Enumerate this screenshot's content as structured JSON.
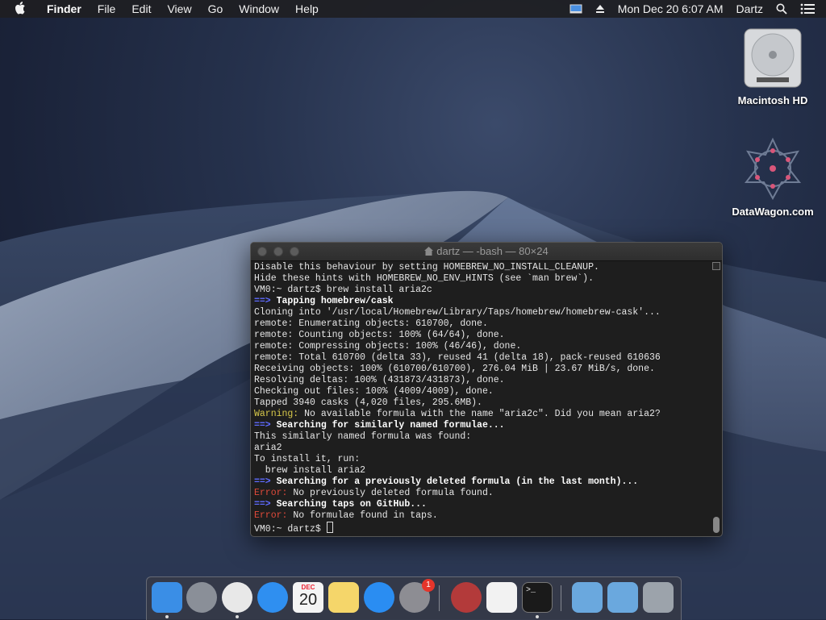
{
  "menubar": {
    "items": [
      "Finder",
      "File",
      "Edit",
      "View",
      "Go",
      "Window",
      "Help"
    ],
    "datetime": "Mon Dec 20  6:07 AM",
    "user": "Dartz"
  },
  "desktop_icons": [
    {
      "label": "Macintosh HD"
    },
    {
      "label": "DataWagon.com"
    }
  ],
  "terminal": {
    "title": "dartz — -bash — 80×24",
    "lines": [
      {
        "parts": [
          {
            "t": "Disable this behaviour by setting HOMEBREW_NO_INSTALL_CLEANUP.",
            "c": ""
          }
        ]
      },
      {
        "parts": [
          {
            "t": "Hide these hints with HOMEBREW_NO_ENV_HINTS (see `man brew`).",
            "c": ""
          }
        ]
      },
      {
        "parts": [
          {
            "t": "VM0:~ dartz$ brew install aria2c",
            "c": ""
          }
        ]
      },
      {
        "parts": [
          {
            "t": "==> ",
            "c": "arrow"
          },
          {
            "t": "Tapping homebrew/cask",
            "c": "bold"
          }
        ]
      },
      {
        "parts": [
          {
            "t": "Cloning into '/usr/local/Homebrew/Library/Taps/homebrew/homebrew-cask'...",
            "c": ""
          }
        ]
      },
      {
        "parts": [
          {
            "t": "remote: Enumerating objects: 610700, done.",
            "c": ""
          }
        ]
      },
      {
        "parts": [
          {
            "t": "remote: Counting objects: 100% (64/64), done.",
            "c": ""
          }
        ]
      },
      {
        "parts": [
          {
            "t": "remote: Compressing objects: 100% (46/46), done.",
            "c": ""
          }
        ]
      },
      {
        "parts": [
          {
            "t": "remote: Total 610700 (delta 33), reused 41 (delta 18), pack-reused 610636",
            "c": ""
          }
        ]
      },
      {
        "parts": [
          {
            "t": "Receiving objects: 100% (610700/610700), 276.04 MiB | 23.67 MiB/s, done.",
            "c": ""
          }
        ]
      },
      {
        "parts": [
          {
            "t": "Resolving deltas: 100% (431873/431873), done.",
            "c": ""
          }
        ]
      },
      {
        "parts": [
          {
            "t": "Checking out files: 100% (4009/4009), done.",
            "c": ""
          }
        ]
      },
      {
        "parts": [
          {
            "t": "Tapped 3940 casks (4,020 files, 295.6MB).",
            "c": ""
          }
        ]
      },
      {
        "parts": [
          {
            "t": "Warning:",
            "c": "warn"
          },
          {
            "t": " No available formula with the name \"aria2c\". Did you mean aria2?",
            "c": ""
          }
        ]
      },
      {
        "parts": [
          {
            "t": "==> ",
            "c": "arrow"
          },
          {
            "t": "Searching for similarly named formulae...",
            "c": "bold"
          }
        ]
      },
      {
        "parts": [
          {
            "t": "This similarly named formula was found:",
            "c": ""
          }
        ]
      },
      {
        "parts": [
          {
            "t": "aria2",
            "c": ""
          }
        ]
      },
      {
        "parts": [
          {
            "t": "To install it, run:",
            "c": ""
          }
        ]
      },
      {
        "parts": [
          {
            "t": "  brew install aria2",
            "c": ""
          }
        ]
      },
      {
        "parts": [
          {
            "t": "==> ",
            "c": "arrow"
          },
          {
            "t": "Searching for a previously deleted formula (in the last month)...",
            "c": "bold"
          }
        ]
      },
      {
        "parts": [
          {
            "t": "Error:",
            "c": "err"
          },
          {
            "t": " No previously deleted formula found.",
            "c": ""
          }
        ]
      },
      {
        "parts": [
          {
            "t": "==> ",
            "c": "arrow"
          },
          {
            "t": "Searching taps on GitHub...",
            "c": "bold"
          }
        ]
      },
      {
        "parts": [
          {
            "t": "Error:",
            "c": "err"
          },
          {
            "t": " No formulae found in taps.",
            "c": ""
          }
        ]
      },
      {
        "parts": [
          {
            "t": "VM0:~ dartz$ ",
            "c": ""
          }
        ],
        "cursor": true
      }
    ]
  },
  "dock": {
    "items": [
      {
        "name": "finder",
        "color": "#3a8ee6",
        "running": true
      },
      {
        "name": "launchpad",
        "color": "#8a8f98",
        "running": false
      },
      {
        "name": "chrome",
        "color": "#e8e8e8",
        "running": true
      },
      {
        "name": "safari",
        "color": "#2f8ff0",
        "running": false
      },
      {
        "name": "calendar",
        "color": "#f4f4f4",
        "running": false,
        "text_top": "DEC",
        "text_main": "20"
      },
      {
        "name": "notes",
        "color": "#f5d66a",
        "running": false
      },
      {
        "name": "app-store",
        "color": "#2a8df2",
        "running": false
      },
      {
        "name": "system-preferences",
        "color": "#8d8d93",
        "running": false,
        "badge": "1"
      },
      {
        "name": "photo-booth",
        "color": "#b33a3a",
        "running": false
      },
      {
        "name": "textedit",
        "color": "#f2f2f2",
        "running": false
      },
      {
        "name": "terminal",
        "color": "#1a1a1a",
        "running": true
      },
      {
        "name": "applications-folder",
        "color": "#6aa8de",
        "running": false
      },
      {
        "name": "downloads-folder",
        "color": "#6aa8de",
        "running": false
      },
      {
        "name": "trash",
        "color": "#9ca3ab",
        "running": false
      }
    ]
  }
}
